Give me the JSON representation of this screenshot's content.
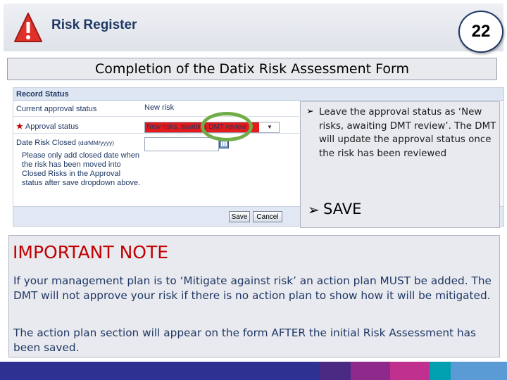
{
  "header": {
    "title": "Risk Register",
    "page_number": "22"
  },
  "subtitle": "Completion of the Datix Risk Assessment Form",
  "form": {
    "section_title": "Record Status",
    "current_approval_label": "Current approval status",
    "current_approval_value": "New risk",
    "approval_label": "Approval status",
    "approval_selected": "New risks, awaiting DMT review",
    "date_closed_label": "Date Risk Closed",
    "date_format": "(dd/MM/yyyy)",
    "date_value": "",
    "hint": "Please only add closed date when the risk has been moved into Closed Risks in the Approval status after save dropdown above.",
    "save_label": "Save",
    "cancel_label": "Cancel"
  },
  "callout": {
    "instruction": "Leave the approval status as ‘New risks, awaiting DMT review’. The DMT will update the approval status once the risk has been reviewed",
    "save_text": "SAVE"
  },
  "note": {
    "heading": "IMPORTANT NOTE",
    "paragraph1": "If your management plan is to ‘Mitigate against risk’ an action plan MUST be added. The DMT will not approve your risk if there is no action plan to show how it will be mitigated.",
    "paragraph2": "The action plan section will appear on the form AFTER the initial Risk Assessment has been saved."
  },
  "colors": {
    "title_navy": "#1f3864",
    "warning_red": "#c00000",
    "highlight_green": "#70ad47",
    "select_red": "#e51a1a",
    "footer_stripe": [
      "#2e3192",
      "#4b2a84",
      "#8e2a8c",
      "#c0308e",
      "#00a0b0",
      "#5b9bd5"
    ]
  },
  "icons": {
    "header": "warning-triangle-icon",
    "date_picker": "calendar-icon",
    "dropdown": "chevron-down-icon",
    "bullet": "arrow-bullet-icon"
  }
}
